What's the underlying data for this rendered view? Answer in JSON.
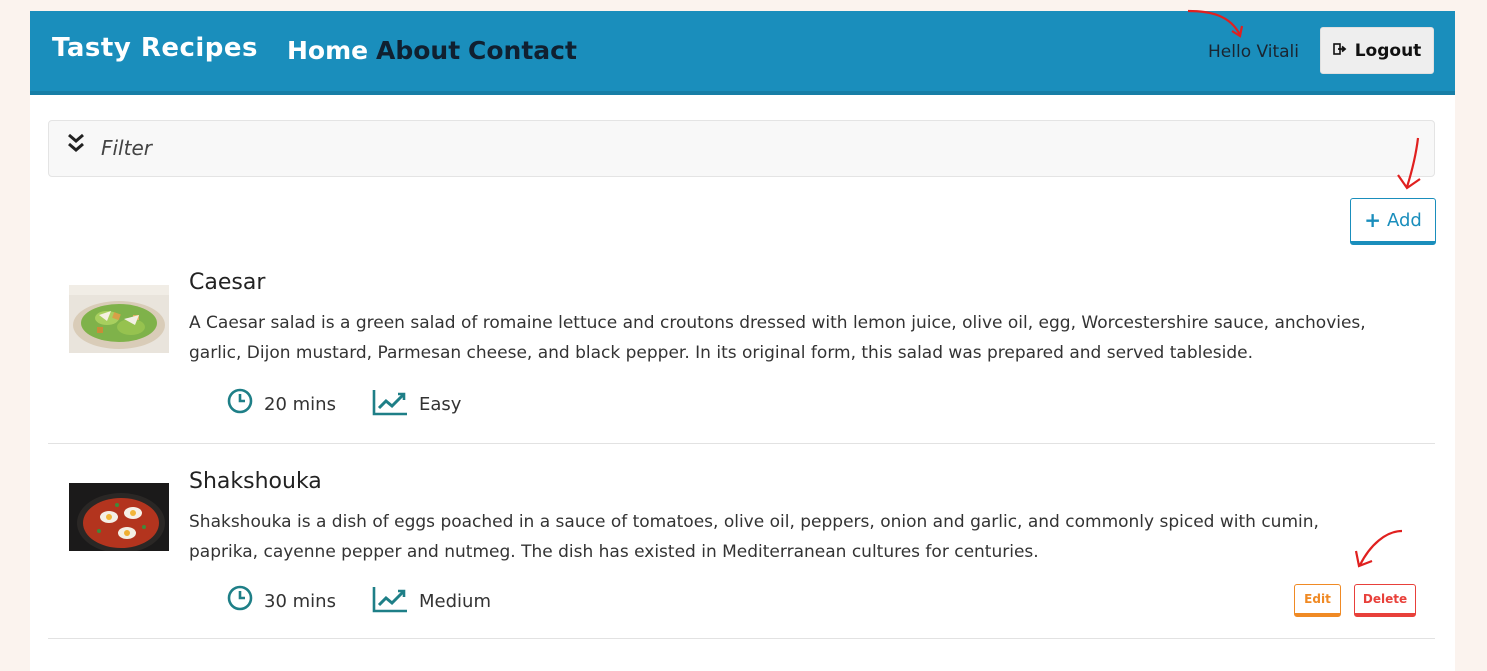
{
  "colors": {
    "brand": "#1a8ebc",
    "edit": "#f08a24",
    "delete": "#e8403a",
    "annotation": "#e0201f"
  },
  "header": {
    "brand": "Tasty Recipes",
    "nav": [
      "Home",
      "About",
      "Contact"
    ],
    "greeting": "Hello Vitali",
    "logout_label": "Logout",
    "logout_icon": "sign-out-icon"
  },
  "filter": {
    "label": "Filter",
    "icon": "double-chevron-down-icon"
  },
  "add_button": {
    "label": "Add",
    "icon": "plus-icon"
  },
  "recipes": [
    {
      "title": "Caesar",
      "description": "A Caesar salad is a green salad of romaine lettuce and croutons dressed with lemon juice, olive oil, egg, Worcestershire sauce, anchovies, garlic, Dijon mustard, Parmesan cheese, and black pepper. In its original form, this salad was prepared and served tableside.",
      "time": "20 mins",
      "difficulty": "Easy"
    },
    {
      "title": "Shakshouka",
      "description": "Shakshouka is a dish of eggs poached in a sauce of tomatoes, olive oil, peppers, onion and garlic, and commonly spiced with cumin, paprika, cayenne pepper and nutmeg. The dish has existed in Mediterranean cultures for centuries.",
      "time": "30 mins",
      "difficulty": "Medium",
      "edit_label": "Edit",
      "delete_label": "Delete"
    }
  ]
}
